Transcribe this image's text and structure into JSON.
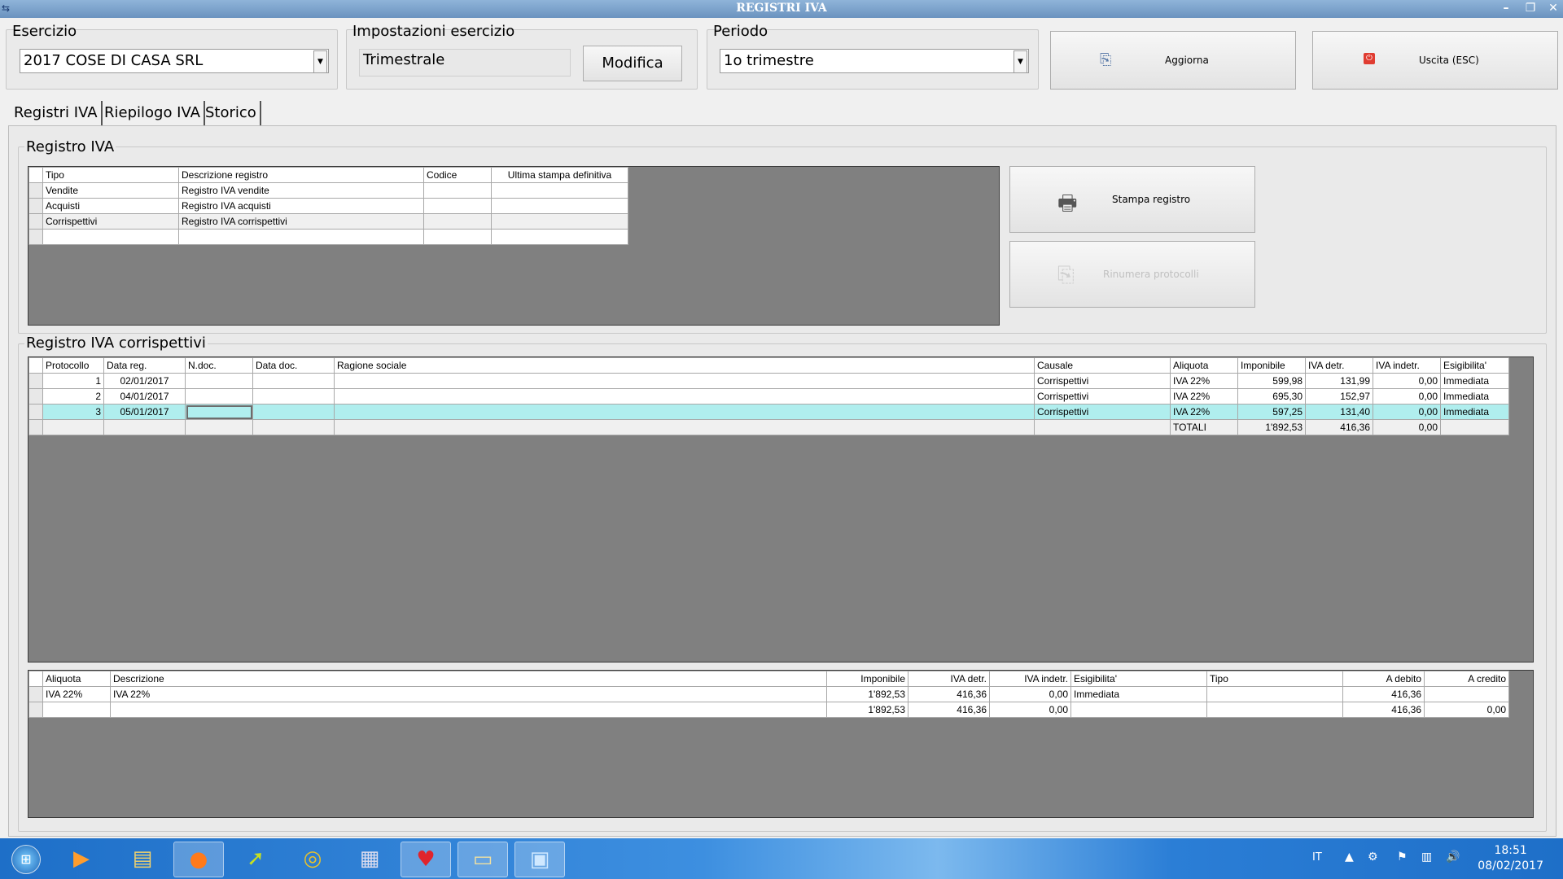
{
  "window": {
    "title": "REGISTRI IVA"
  },
  "esercizio": {
    "label": "Esercizio",
    "value": "2017 COSE DI CASA SRL"
  },
  "impostazioni": {
    "label": "Impostazioni esercizio",
    "value": "Trimestrale",
    "modifica_label": "Modifica"
  },
  "periodo": {
    "label": "Periodo",
    "value": "1o trimestre"
  },
  "aggiorna_label": "Aggiorna",
  "uscita_label": "Uscita (ESC)",
  "tabs": [
    "Registri IVA",
    "Riepilogo IVA",
    "Storico"
  ],
  "registro_iva": {
    "label": "Registro IVA",
    "columns": [
      "Tipo",
      "Descrizione registro",
      "Codice",
      "Ultima stampa definitiva"
    ],
    "rows": [
      [
        "Vendite",
        "Registro IVA vendite",
        "",
        ""
      ],
      [
        "Acquisti",
        "Registro IVA acquisti",
        "",
        ""
      ],
      [
        "Corrispettivi",
        "Registro IVA corrispettivi",
        "",
        ""
      ],
      [
        "",
        "",
        "",
        ""
      ]
    ]
  },
  "stampa_label": "Stampa registro",
  "rinumera_label": "Rinumera protocolli",
  "registro_corr": {
    "label": "Registro IVA corrispettivi",
    "columns": [
      "Protocollo",
      "Data reg.",
      "N.doc.",
      "Data doc.",
      "Ragione sociale",
      "Causale",
      "Aliquota",
      "Imponibile",
      "IVA detr.",
      "IVA indetr.",
      "Esigibilita'"
    ],
    "rows": [
      [
        "1",
        "02/01/2017",
        "",
        "",
        "",
        "Corrispettivi",
        "IVA 22%",
        "599,98",
        "131,99",
        "0,00",
        "Immediata"
      ],
      [
        "2",
        "04/01/2017",
        "",
        "",
        "",
        "Corrispettivi",
        "IVA 22%",
        "695,30",
        "152,97",
        "0,00",
        "Immediata"
      ],
      [
        "3",
        "05/01/2017",
        "",
        "",
        "",
        "Corrispettivi",
        "IVA 22%",
        "597,25",
        "131,40",
        "0,00",
        "Immediata"
      ]
    ],
    "totals": [
      "",
      "",
      "",
      "",
      "",
      "",
      "TOTALI",
      "1'892,53",
      "416,36",
      "0,00",
      ""
    ]
  },
  "riepilogo": {
    "columns": [
      "Aliquota",
      "Descrizione",
      "Imponibile",
      "IVA detr.",
      "IVA indetr.",
      "Esigibilita'",
      "Tipo",
      "A debito",
      "A credito"
    ],
    "rows": [
      [
        "IVA 22%",
        "IVA 22%",
        "1'892,53",
        "416,36",
        "0,00",
        "Immediata",
        "",
        "416,36",
        ""
      ],
      [
        "",
        "",
        "1'892,53",
        "416,36",
        "0,00",
        "",
        "",
        "416,36",
        "0,00"
      ]
    ]
  },
  "taskbar": {
    "lang": "IT",
    "time": "18:51",
    "date": "08/02/2017",
    "icons": [
      "start-orb-icon",
      "media-player-icon",
      "file-explorer-icon",
      "firefox-icon",
      "app-arrow-icon",
      "chrome-icon",
      "calculator-icon",
      "strawberry-app-icon",
      "window-app-icon",
      "image-viewer-icon"
    ]
  }
}
